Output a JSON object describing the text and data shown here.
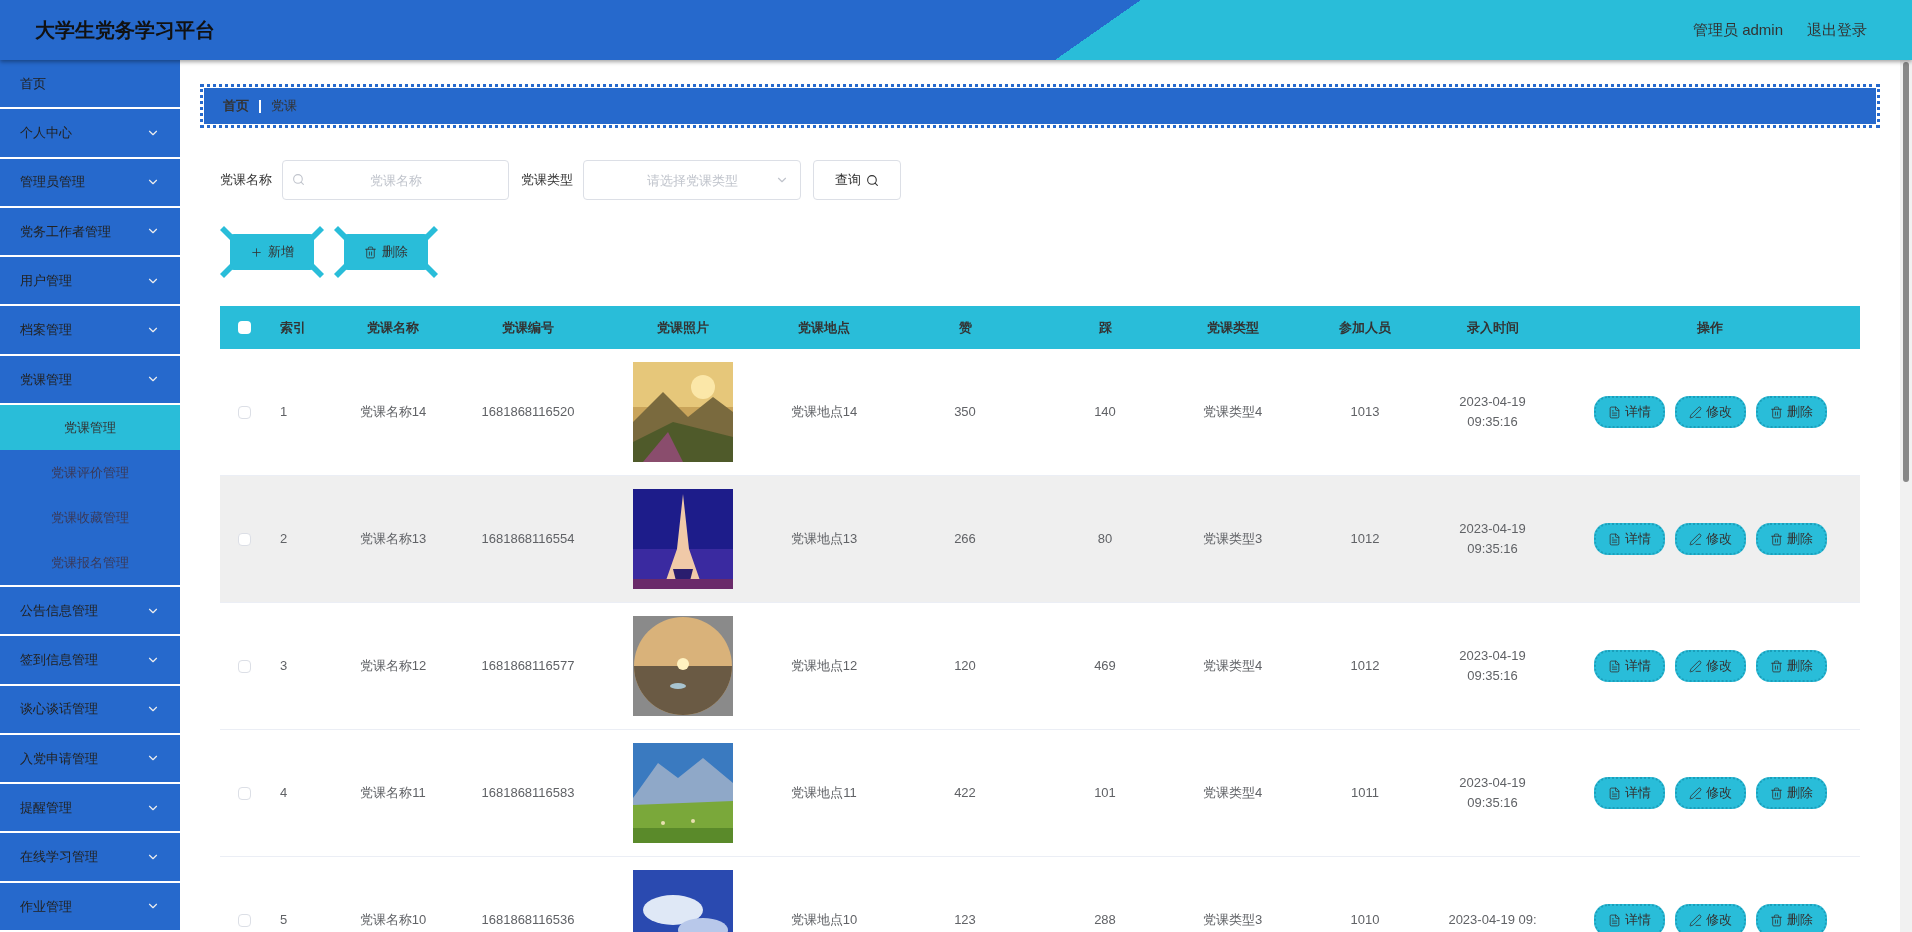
{
  "header": {
    "title": "大学生党务学习平台",
    "user": "管理员 admin",
    "logout": "退出登录"
  },
  "sidebar": {
    "items": [
      {
        "label": "首页",
        "kind": "link"
      },
      {
        "label": "个人中心",
        "kind": "menu"
      },
      {
        "label": "管理员管理",
        "kind": "menu"
      },
      {
        "label": "党务工作者管理",
        "kind": "menu"
      },
      {
        "label": "用户管理",
        "kind": "menu"
      },
      {
        "label": "档案管理",
        "kind": "menu"
      },
      {
        "label": "党课管理",
        "kind": "menu",
        "children": [
          {
            "label": "党课管理",
            "selected": true
          },
          {
            "label": "党课评价管理",
            "selected": false
          },
          {
            "label": "党课收藏管理",
            "selected": false
          },
          {
            "label": "党课报名管理",
            "selected": false
          }
        ]
      },
      {
        "label": "公告信息管理",
        "kind": "menu"
      },
      {
        "label": "签到信息管理",
        "kind": "menu"
      },
      {
        "label": "谈心谈话管理",
        "kind": "menu"
      },
      {
        "label": "入党申请管理",
        "kind": "menu"
      },
      {
        "label": "提醒管理",
        "kind": "menu"
      },
      {
        "label": "在线学习管理",
        "kind": "menu"
      },
      {
        "label": "作业管理",
        "kind": "menu"
      }
    ]
  },
  "breadcrumb": [
    "首页",
    "党课"
  ],
  "filters": [
    {
      "label": "党课名称",
      "kind": "text",
      "placeholder": "党课名称"
    },
    {
      "label": "党课类型",
      "kind": "select",
      "placeholder": "请选择党课类型"
    }
  ],
  "search_button": "查询",
  "actions": [
    {
      "label": "新增",
      "kind": "add"
    },
    {
      "label": "删除",
      "kind": "delete"
    }
  ],
  "table": {
    "header_checked": false,
    "columns": [
      "索引",
      "党课名称",
      "党课编号",
      "党课照片",
      "党课地点",
      "赞",
      "踩",
      "党课类型",
      "参加人员",
      "录入时间",
      "操作"
    ],
    "rows": [
      {
        "checked": false,
        "highlighted": false,
        "index": "1",
        "name": "党课名称14",
        "code": "1681868116520",
        "photo": {
          "kind": "picture"
        },
        "place": "党课地点14",
        "likes": "350",
        "dislikes": "140",
        "type": "党课类型4",
        "participants": "1013",
        "time": "2023-04-19 09:35:16",
        "actions": [
          {
            "label": "详情",
            "kind": "detail"
          },
          {
            "label": "修改",
            "kind": "edit"
          },
          {
            "label": "删除",
            "kind": "delete"
          }
        ]
      },
      {
        "checked": false,
        "highlighted": true,
        "index": "2",
        "name": "党课名称13",
        "code": "1681868116554",
        "photo": {
          "kind": "picture"
        },
        "place": "党课地点13",
        "likes": "266",
        "dislikes": "80",
        "type": "党课类型3",
        "participants": "1012",
        "time": "2023-04-19 09:35:16",
        "actions": [
          {
            "label": "详情",
            "kind": "detail"
          },
          {
            "label": "修改",
            "kind": "edit"
          },
          {
            "label": "删除",
            "kind": "delete"
          }
        ]
      },
      {
        "checked": false,
        "highlighted": false,
        "index": "3",
        "name": "党课名称12",
        "code": "1681868116577",
        "photo": {
          "kind": "picture"
        },
        "place": "党课地点12",
        "likes": "120",
        "dislikes": "469",
        "type": "党课类型4",
        "participants": "1012",
        "time": "2023-04-19 09:35:16",
        "actions": [
          {
            "label": "详情",
            "kind": "detail"
          },
          {
            "label": "修改",
            "kind": "edit"
          },
          {
            "label": "删除",
            "kind": "delete"
          }
        ]
      },
      {
        "checked": false,
        "highlighted": false,
        "index": "4",
        "name": "党课名称11",
        "code": "1681868116583",
        "photo": {
          "kind": "picture"
        },
        "place": "党课地点11",
        "likes": "422",
        "dislikes": "101",
        "type": "党课类型4",
        "participants": "1011",
        "time": "2023-04-19 09:35:16",
        "actions": [
          {
            "label": "详情",
            "kind": "detail"
          },
          {
            "label": "修改",
            "kind": "edit"
          },
          {
            "label": "删除",
            "kind": "delete"
          }
        ]
      },
      {
        "checked": false,
        "highlighted": false,
        "index": "5",
        "name": "党课名称10",
        "code": "1681868116536",
        "photo": {
          "kind": "picture"
        },
        "place": "党课地点10",
        "likes": "123",
        "dislikes": "288",
        "type": "党课类型3",
        "participants": "1010",
        "time": "2023-04-19 09:",
        "actions": [
          {
            "label": "详情",
            "kind": "detail"
          },
          {
            "label": "修改",
            "kind": "edit"
          },
          {
            "label": "删除",
            "kind": "delete"
          }
        ]
      }
    ]
  }
}
